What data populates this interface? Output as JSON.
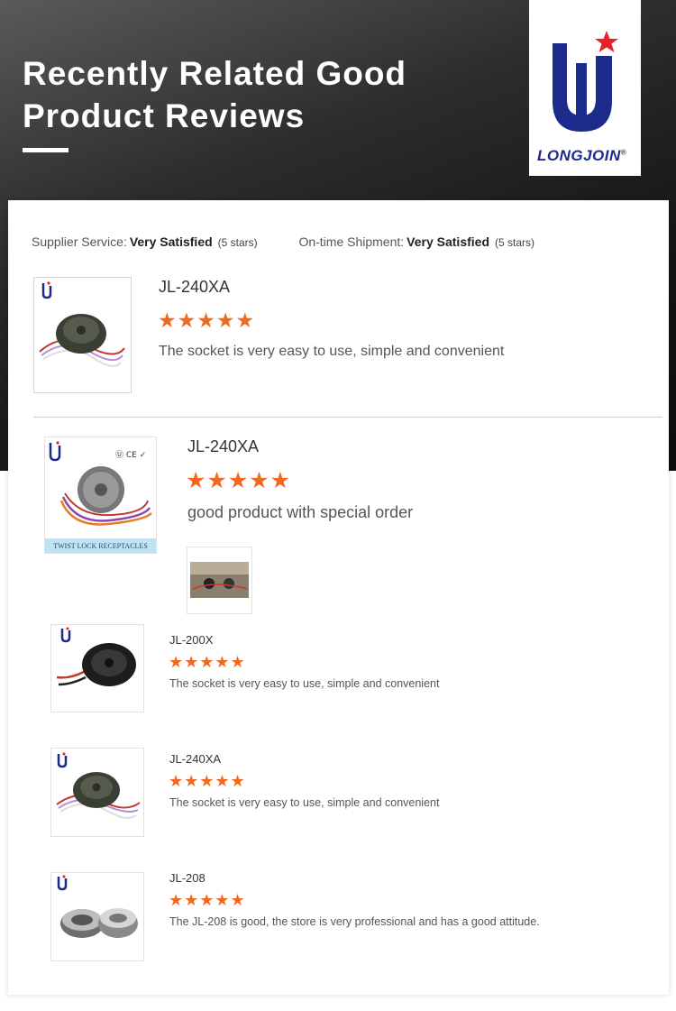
{
  "header": {
    "title_line1": "Recently Related Good",
    "title_line2": "Product Reviews",
    "logo_text": "LONGJOIN",
    "logo_reg": "®"
  },
  "colors": {
    "star": "#f0691e",
    "logo_blue": "#1c2a8c",
    "logo_red": "#e8222b"
  },
  "summary": {
    "supplier_label": "Supplier Service:",
    "supplier_value": "Very Satisfied",
    "supplier_note": "(5 stars)",
    "shipment_label": "On-time Shipment:",
    "shipment_value": "Very Satisfied",
    "shipment_note": "(5 stars)"
  },
  "reviews": [
    {
      "product": "JL-240XA",
      "rating": 5,
      "stars": "★★★★★",
      "comment": "The socket is very easy to use, simple and convenient"
    },
    {
      "product": "JL-240XA",
      "rating": 5,
      "stars": "★★★★★",
      "comment": "good product with special order",
      "badge_text": "TWIST LOCK RECEPTACLES"
    },
    {
      "product": "JL-200X",
      "rating": 5,
      "stars": "★★★★★",
      "comment": "The socket is very easy to use, simple and convenient"
    },
    {
      "product": "JL-240XA",
      "rating": 5,
      "stars": "★★★★★",
      "comment": "The socket is very easy to use, simple and convenient"
    },
    {
      "product": "JL-208",
      "rating": 5,
      "stars": "★★★★★",
      "comment": "The JL-208 is good, the store is very professional and has a good attitude."
    }
  ]
}
